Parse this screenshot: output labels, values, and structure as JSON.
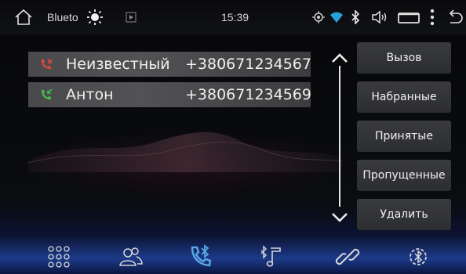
{
  "statusbar": {
    "bluetooth_label": "Blueto",
    "time": "15:39"
  },
  "calls": [
    {
      "name": "Неизвестный",
      "number": "+380671234567",
      "type": "missed"
    },
    {
      "name": "Антон",
      "number": "+380671234569",
      "type": "received"
    }
  ],
  "buttons": {
    "call": "Вызов",
    "dialed": "Набранные",
    "received": "Принятые",
    "missed": "Пропущенные",
    "delete": "Удалить"
  },
  "colors": {
    "missed_icon": "#e0493a",
    "received_icon": "#3fbf4a",
    "active_nav": "#5aa8e8"
  },
  "nav": {
    "active": "bluetooth-phone",
    "items": [
      "apps-grid-icon",
      "contacts-icon",
      "bluetooth-phone-icon",
      "bluetooth-music-icon",
      "link-icon",
      "bluetooth-settings-icon"
    ]
  }
}
